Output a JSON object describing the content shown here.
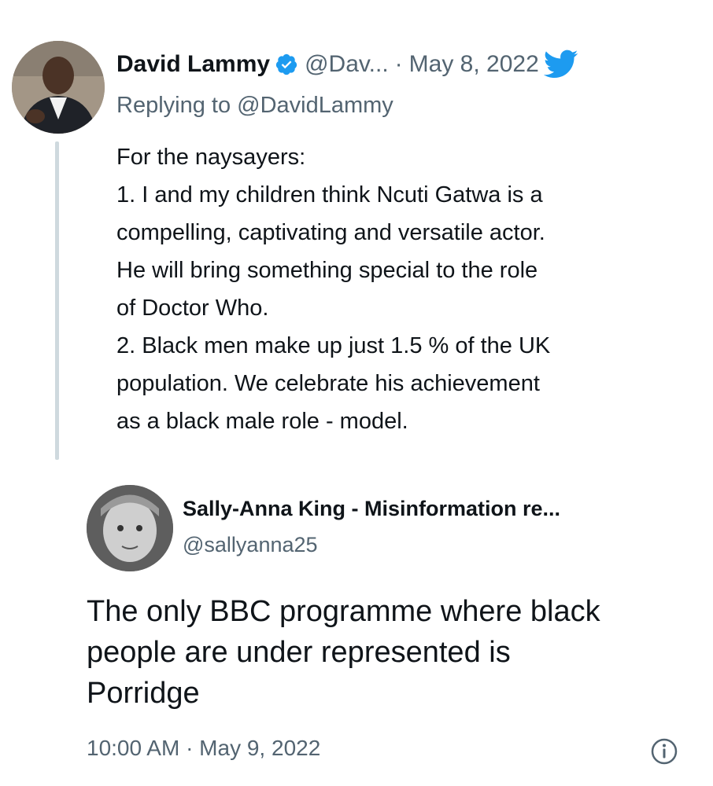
{
  "tweet": {
    "author_name": "David Lammy",
    "handle": "@Dav...",
    "separator": "·",
    "date": "May 8, 2022",
    "replying_to": "Replying to @DavidLammy",
    "body_lines": [
      "For the naysayers:",
      "1. I and my children think Ncuti Gatwa is a",
      "compelling, captivating and versatile actor.",
      "He will bring something special to the role",
      "of Doctor Who.",
      "2. Black men make up just 1.5 % of the UK",
      "population. We celebrate his achievement",
      "as a black male role - model."
    ],
    "verified_icon": "verified-badge-icon",
    "platform_icon": "twitter-bird-icon"
  },
  "reply": {
    "author_name": "Sally-Anna King - Misinformation re...",
    "handle": "@sallyanna25",
    "body_lines": [
      "The only BBC programme where black",
      "people are under represented is",
      "Porridge"
    ],
    "timestamp": "10:00 AM · May 9, 2022",
    "info_icon": "info-icon"
  },
  "colors": {
    "text_primary": "#0f1419",
    "text_secondary": "#536471",
    "verified_blue": "#1d9bf0",
    "twitter_blue": "#1d9bf0",
    "thread_line": "#cfd9de"
  }
}
